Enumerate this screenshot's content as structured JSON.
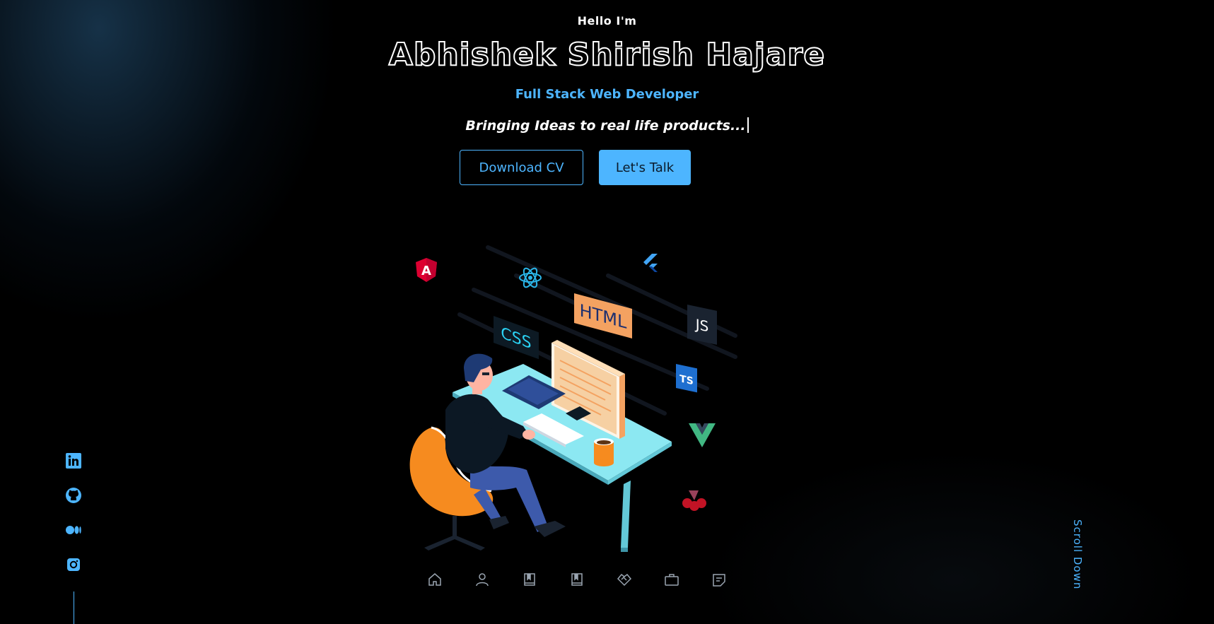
{
  "hero": {
    "greeting": "Hello I'm",
    "name": "Abhishek Shirish Hajare",
    "role": "Full Stack Web Developer",
    "tagline": "Bringing Ideas to real life products..."
  },
  "buttons": {
    "download_cv": "Download CV",
    "lets_talk": "Let's Talk"
  },
  "illustration": {
    "labels": {
      "html": "HTML",
      "css": "CSS",
      "js": "JS",
      "ts": "TS"
    },
    "tech_icons": [
      "angular-icon",
      "react-icon",
      "flutter-icon",
      "js-icon",
      "ts-icon",
      "vue-icon",
      "jest-icon"
    ]
  },
  "socials": [
    "linkedin-icon",
    "github-icon",
    "medium-icon",
    "instagram-icon"
  ],
  "nav": [
    "home-icon",
    "user-icon",
    "book-icon",
    "book-icon",
    "handshake-icon",
    "briefcase-icon",
    "message-icon"
  ],
  "scroll_down": "Scroll Down",
  "colors": {
    "accent": "#4db5ff",
    "background": "#000000"
  }
}
